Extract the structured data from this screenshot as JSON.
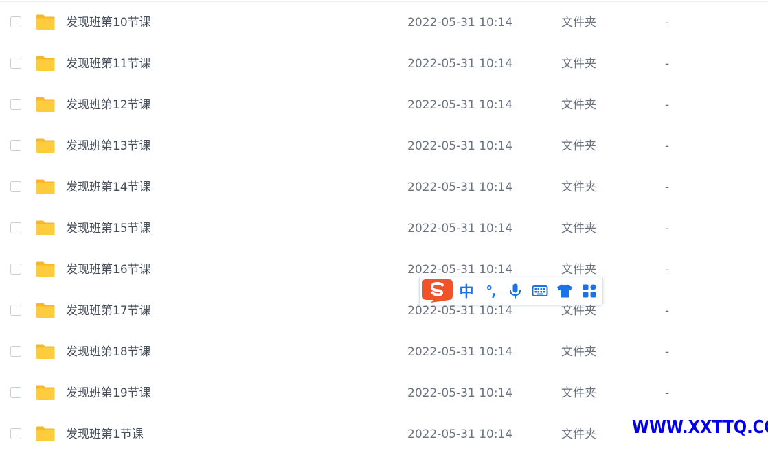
{
  "files": [
    {
      "name": "发现班第10节课",
      "modified": "2022-05-31 10:14",
      "type": "文件夹",
      "size": "-"
    },
    {
      "name": "发现班第11节课",
      "modified": "2022-05-31 10:14",
      "type": "文件夹",
      "size": "-"
    },
    {
      "name": "发现班第12节课",
      "modified": "2022-05-31 10:14",
      "type": "文件夹",
      "size": "-"
    },
    {
      "name": "发现班第13节课",
      "modified": "2022-05-31 10:14",
      "type": "文件夹",
      "size": "-"
    },
    {
      "name": "发现班第14节课",
      "modified": "2022-05-31 10:14",
      "type": "文件夹",
      "size": "-"
    },
    {
      "name": "发现班第15节课",
      "modified": "2022-05-31 10:14",
      "type": "文件夹",
      "size": "-"
    },
    {
      "name": "发现班第16节课",
      "modified": "2022-05-31 10:14",
      "type": "文件夹",
      "size": "-"
    },
    {
      "name": "发现班第17节课",
      "modified": "2022-05-31 10:14",
      "type": "文件夹",
      "size": "-"
    },
    {
      "name": "发现班第18节课",
      "modified": "2022-05-31 10:14",
      "type": "文件夹",
      "size": "-"
    },
    {
      "name": "发现班第19节课",
      "modified": "2022-05-31 10:14",
      "type": "文件夹",
      "size": "-"
    },
    {
      "name": "发现班第1节课",
      "modified": "2022-05-31 10:14",
      "type": "文件夹",
      "size": ""
    }
  ],
  "ime": {
    "logo_icon": "sogou-s-logo-icon",
    "lang_label": "中",
    "punct_label": "°,",
    "icons": [
      "microphone-icon",
      "keyboard-icon",
      "tshirt-skin-icon",
      "apps-grid-icon"
    ],
    "brand_color": "#f0522a",
    "accent_color": "#1a73e8"
  },
  "watermark": "WWW.XXTTQ.COM",
  "colors": {
    "folder": "#ffcc3d",
    "text": "#454d5a",
    "muted": "#6b7280"
  }
}
